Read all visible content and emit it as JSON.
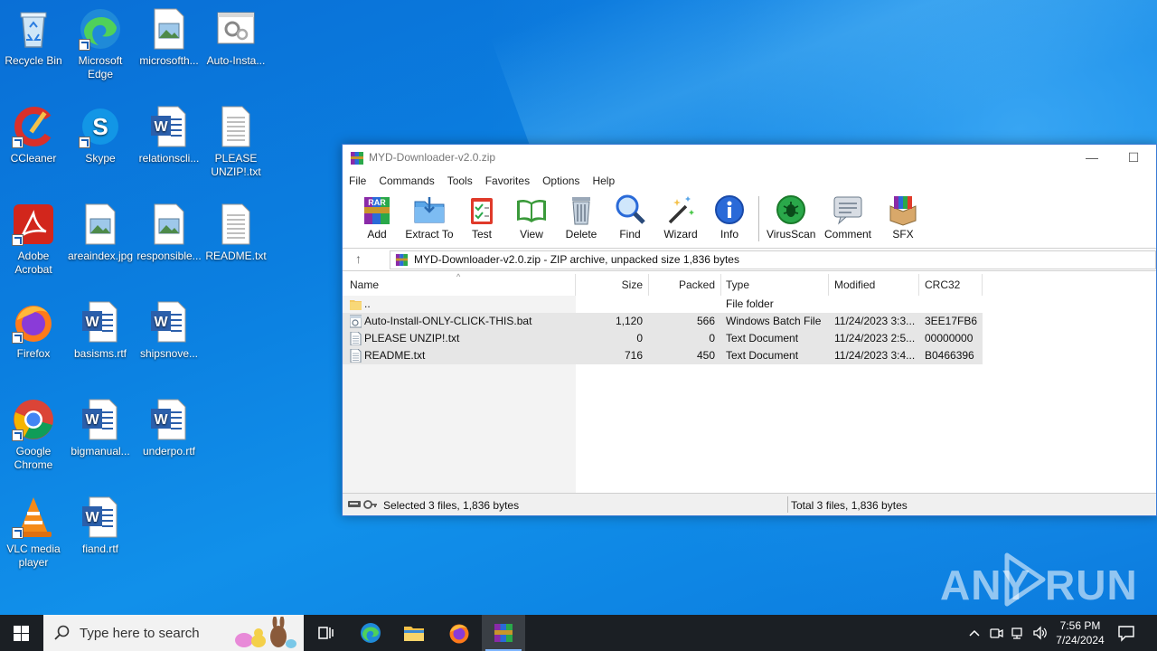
{
  "desktop": {
    "icons": [
      {
        "label": "Recycle Bin"
      },
      {
        "label": "Microsoft Edge"
      },
      {
        "label": "microsofth..."
      },
      {
        "label": "Auto-Insta..."
      },
      {
        "label": "CCleaner"
      },
      {
        "label": "Skype"
      },
      {
        "label": "relationscli..."
      },
      {
        "label": "PLEASE UNZIP!.txt"
      },
      {
        "label": "Adobe Acrobat"
      },
      {
        "label": "areaindex.jpg"
      },
      {
        "label": "responsible..."
      },
      {
        "label": "README.txt"
      },
      {
        "label": "Firefox"
      },
      {
        "label": "basisms.rtf"
      },
      {
        "label": "shipsnove..."
      },
      {
        "label": "Google Chrome"
      },
      {
        "label": "bigmanual..."
      },
      {
        "label": "underpo.rtf"
      },
      {
        "label": "VLC media player"
      },
      {
        "label": "fiand.rtf"
      }
    ]
  },
  "window": {
    "title": "MYD-Downloader-v2.0.zip",
    "minimize_glyph": "—",
    "maximize_glyph": "☐",
    "menu": [
      "File",
      "Commands",
      "Tools",
      "Favorites",
      "Options",
      "Help"
    ],
    "toolbar": [
      "Add",
      "Extract To",
      "Test",
      "View",
      "Delete",
      "Find",
      "Wizard",
      "Info",
      "VirusScan",
      "Comment",
      "SFX"
    ],
    "address": "MYD-Downloader-v2.0.zip - ZIP archive, unpacked size 1,836 bytes",
    "up_glyph": "↑",
    "columns": {
      "name": "Name",
      "size": "Size",
      "packed": "Packed",
      "type": "Type",
      "modified": "Modified",
      "crc": "CRC32"
    },
    "sort_glyph": "^",
    "rows": [
      {
        "name": "..",
        "size": "",
        "packed": "",
        "type": "File folder",
        "modified": "",
        "crc": "",
        "icon": "folder-icon"
      },
      {
        "name": "Auto-Install-ONLY-CLICK-THIS.bat",
        "size": "1,120",
        "packed": "566",
        "type": "Windows Batch File",
        "modified": "11/24/2023 3:3...",
        "crc": "3EE17FB6",
        "icon": "batch-file-icon"
      },
      {
        "name": "PLEASE UNZIP!.txt",
        "size": "0",
        "packed": "0",
        "type": "Text Document",
        "modified": "11/24/2023 2:5...",
        "crc": "00000000",
        "icon": "text-file-icon"
      },
      {
        "name": "README.txt",
        "size": "716",
        "packed": "450",
        "type": "Text Document",
        "modified": "11/24/2023 3:4...",
        "crc": "B0466396",
        "icon": "text-file-icon"
      }
    ],
    "status_left": "Selected 3 files, 1,836 bytes",
    "status_right": "Total 3 files, 1,836 bytes"
  },
  "watermark": {
    "left": "ANY",
    "right": "RUN"
  },
  "taskbar": {
    "search_placeholder": "Type here to search",
    "time": "7:56 PM",
    "date": "7/24/2024"
  },
  "colors": {
    "accent": "#0a78dc",
    "taskbar": "#1b1f24",
    "selection": "#e6e6e6"
  }
}
